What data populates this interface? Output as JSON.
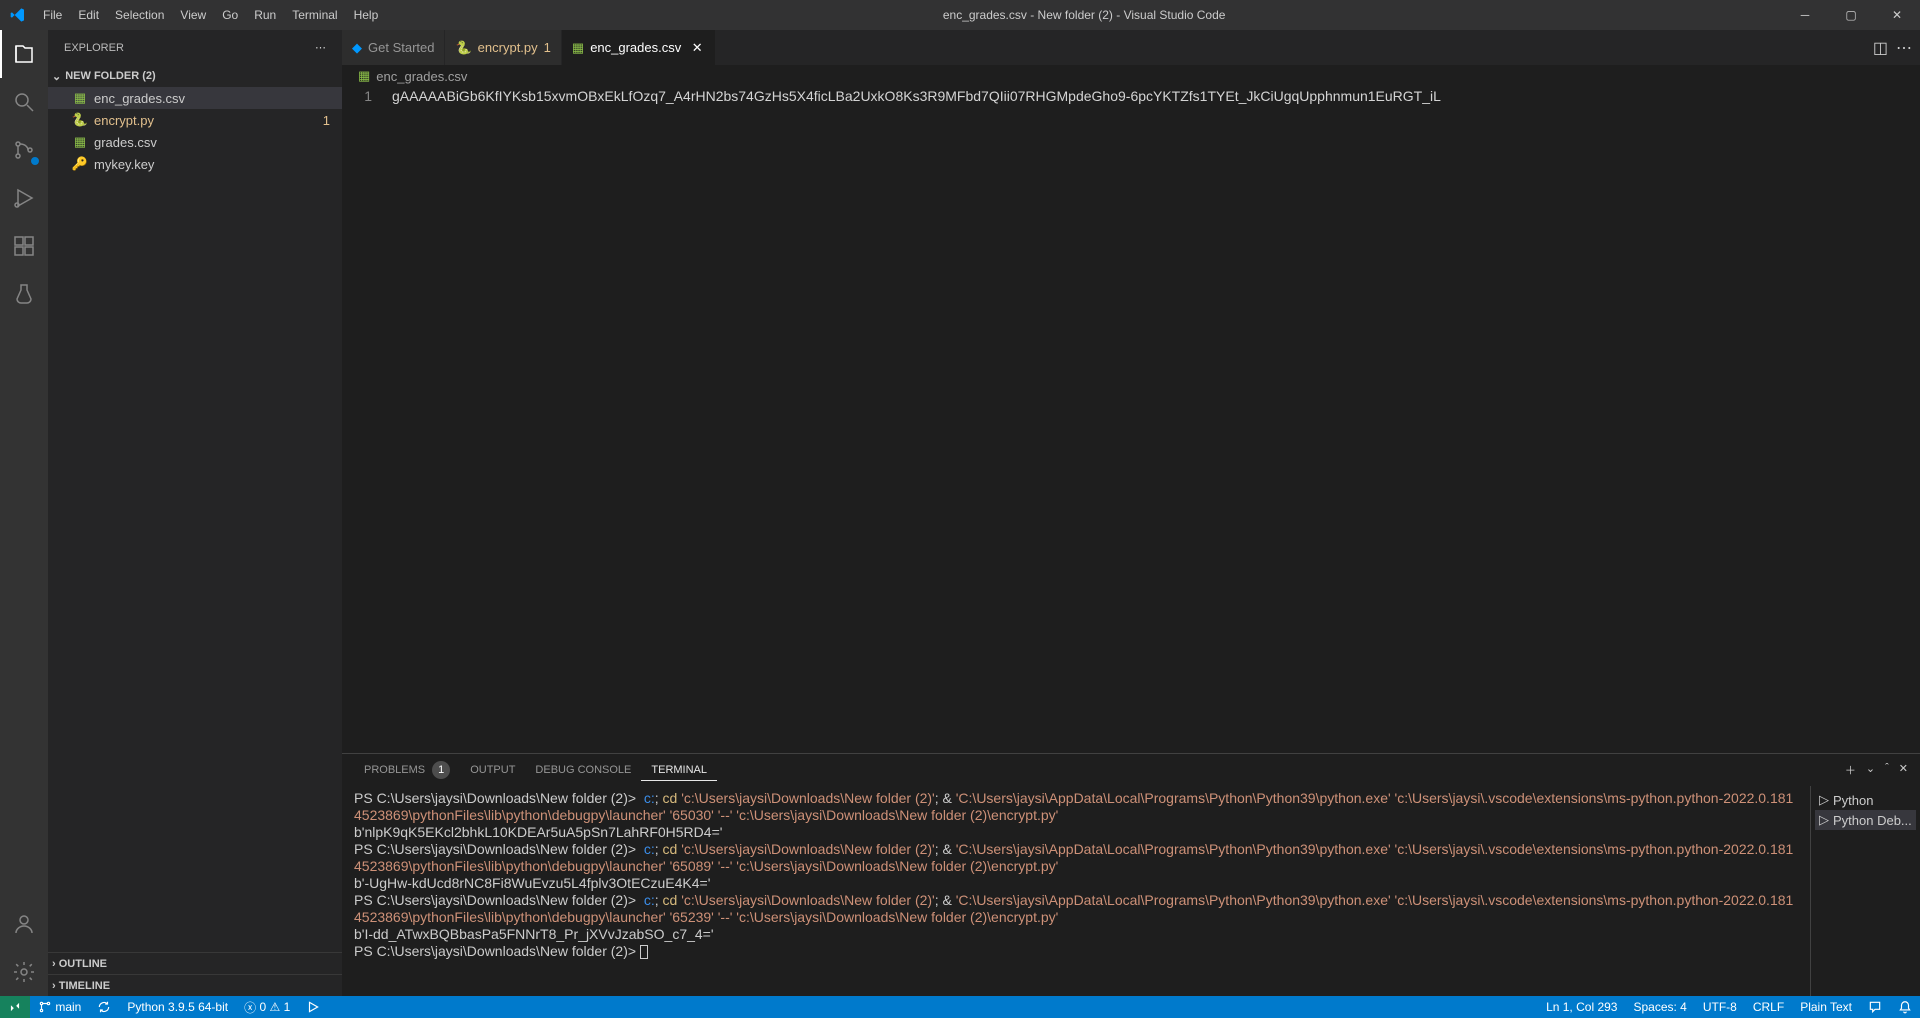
{
  "titlebar": {
    "title": "enc_grades.csv - New folder (2) - Visual Studio Code",
    "menu": [
      "File",
      "Edit",
      "Selection",
      "View",
      "Go",
      "Run",
      "Terminal",
      "Help"
    ]
  },
  "sidebar": {
    "title": "EXPLORER",
    "folder": "NEW FOLDER (2)",
    "files": [
      {
        "name": "enc_grades.csv",
        "icon": "csv",
        "selected": true,
        "modified": false
      },
      {
        "name": "encrypt.py",
        "icon": "python",
        "selected": false,
        "modified": true,
        "badge": "1"
      },
      {
        "name": "grades.csv",
        "icon": "csv",
        "selected": false,
        "modified": false
      },
      {
        "name": "mykey.key",
        "icon": "key",
        "selected": false,
        "modified": false
      }
    ],
    "sections": [
      "OUTLINE",
      "TIMELINE"
    ]
  },
  "tabs": [
    {
      "label": "Get Started",
      "icon": "vscode",
      "active": false,
      "modified": false
    },
    {
      "label": "encrypt.py",
      "icon": "python",
      "active": false,
      "modified": true,
      "badge": "1"
    },
    {
      "label": "enc_grades.csv",
      "icon": "csv",
      "active": true,
      "modified": false
    }
  ],
  "breadcrumb": {
    "label": "enc_grades.csv",
    "icon": "csv"
  },
  "editor": {
    "lines": [
      {
        "num": "1",
        "text": "gAAAAABiGb6KfIYKsb15xvmOBxEkLfOzq7_A4rHN2bs74GzHs5X4ficLBa2UxkO8Ks3R9MFbd7QIii07RHGMpdeGho9-6pcYKTZfs1TYEt_JkCiUgqUpphnmun1EuRGT_iL"
      }
    ]
  },
  "panel": {
    "tabs": [
      {
        "label": "PROBLEMS",
        "badge": "1",
        "active": false
      },
      {
        "label": "OUTPUT",
        "active": false
      },
      {
        "label": "DEBUG CONSOLE",
        "active": false
      },
      {
        "label": "TERMINAL",
        "active": true
      }
    ],
    "term_list": [
      {
        "label": "Python",
        "active": false
      },
      {
        "label": "Python Deb...",
        "active": true
      }
    ],
    "terminal_segments": [
      {
        "t": "PS C:\\Users\\jaysi\\Downloads\\New folder (2)>  ",
        "c": ""
      },
      {
        "t": "c:",
        "c": "cyan"
      },
      {
        "t": "; ",
        "c": ""
      },
      {
        "t": "cd",
        "c": "yellow"
      },
      {
        "t": " ",
        "c": ""
      },
      {
        "t": "'c:\\Users\\jaysi\\Downloads\\New folder (2)'",
        "c": "string"
      },
      {
        "t": "; & ",
        "c": ""
      },
      {
        "t": "'C:\\Users\\jaysi\\AppData\\Local\\Programs\\Python\\Python39\\python.exe' 'c:\\Users\\jaysi\\.vscode\\extensions\\ms-python.python-2022.0.1814523869\\pythonFiles\\lib\\python\\debugpy\\launcher' '65030' '--' 'c:\\Users\\jaysi\\Downloads\\New folder (2)\\encrypt.py'",
        "c": "string"
      },
      {
        "t": "\nb'nlpK9qK5EKcl2bhkL10KDEAr5uA5pSn7LahRF0H5RD4='\n",
        "c": ""
      },
      {
        "t": "PS C:\\Users\\jaysi\\Downloads\\New folder (2)>  ",
        "c": ""
      },
      {
        "t": "c:",
        "c": "cyan"
      },
      {
        "t": "; ",
        "c": ""
      },
      {
        "t": "cd",
        "c": "yellow"
      },
      {
        "t": " ",
        "c": ""
      },
      {
        "t": "'c:\\Users\\jaysi\\Downloads\\New folder (2)'",
        "c": "string"
      },
      {
        "t": "; & ",
        "c": ""
      },
      {
        "t": "'C:\\Users\\jaysi\\AppData\\Local\\Programs\\Python\\Python39\\python.exe' 'c:\\Users\\jaysi\\.vscode\\extensions\\ms-python.python-2022.0.1814523869\\pythonFiles\\lib\\python\\debugpy\\launcher' '65089' '--' 'c:\\Users\\jaysi\\Downloads\\New folder (2)\\encrypt.py'",
        "c": "string"
      },
      {
        "t": "\nb'-UgHw-kdUcd8rNC8Fi8WuEvzu5L4fplv3OtECzuE4K4='\n",
        "c": ""
      },
      {
        "t": "PS C:\\Users\\jaysi\\Downloads\\New folder (2)>  ",
        "c": ""
      },
      {
        "t": "c:",
        "c": "cyan"
      },
      {
        "t": "; ",
        "c": ""
      },
      {
        "t": "cd",
        "c": "yellow"
      },
      {
        "t": " ",
        "c": ""
      },
      {
        "t": "'c:\\Users\\jaysi\\Downloads\\New folder (2)'",
        "c": "string"
      },
      {
        "t": "; & ",
        "c": ""
      },
      {
        "t": "'C:\\Users\\jaysi\\AppData\\Local\\Programs\\Python\\Python39\\python.exe' 'c:\\Users\\jaysi\\.vscode\\extensions\\ms-python.python-2022.0.1814523869\\pythonFiles\\lib\\python\\debugpy\\launcher' '65239' '--' 'c:\\Users\\jaysi\\Downloads\\New folder (2)\\encrypt.py'",
        "c": "string"
      },
      {
        "t": "\nb'I-dd_ATwxBQBbasPa5FNNrT8_Pr_jXVvJzabSO_c7_4='\n",
        "c": ""
      },
      {
        "t": "PS C:\\Users\\jaysi\\Downloads\\New folder (2)> ",
        "c": ""
      }
    ]
  },
  "statusbar": {
    "branch": "main",
    "python": "Python 3.9.5 64-bit",
    "errors": "0",
    "warnings": "1",
    "position": "Ln 1, Col 293",
    "spaces": "Spaces: 4",
    "encoding": "UTF-8",
    "eol": "CRLF",
    "language": "Plain Text"
  }
}
